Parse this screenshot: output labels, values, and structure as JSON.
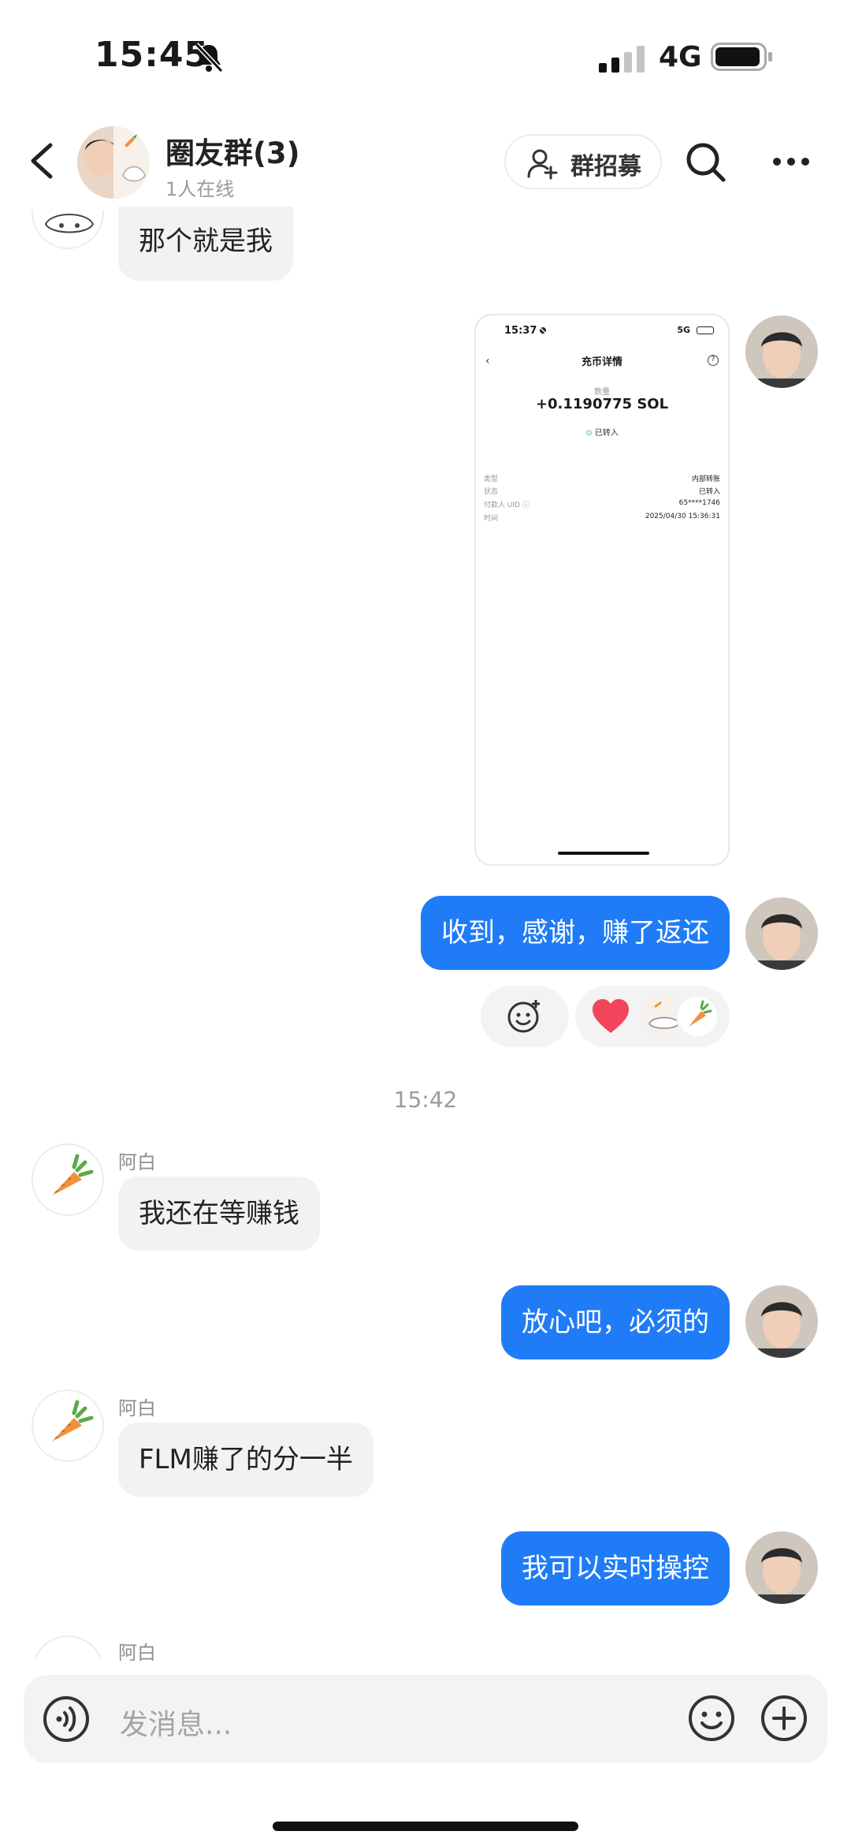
{
  "status_bar": {
    "time": "15:45",
    "network": "4G"
  },
  "header": {
    "title": "圈友群(3)",
    "subtitle": "1人在线",
    "recruit_label": "群招募"
  },
  "messages": {
    "m1": {
      "text": "那个就是我"
    },
    "shared_screenshot": {
      "time": "15:37",
      "network": "5G",
      "title": "充币详情",
      "quantity_label": "数量",
      "amount": "+0.1190775 SOL",
      "status": "已转入",
      "rows": [
        {
          "label": "类型",
          "value": "内部转账"
        },
        {
          "label": "状态",
          "value": "已转入"
        },
        {
          "label": "付款人 UID ⓘ",
          "value": "65****1746"
        },
        {
          "label": "时间",
          "value": "2025/04/30 15:36:31"
        }
      ]
    },
    "m2": {
      "text": "收到，感谢，赚了返还"
    },
    "timestamp": "15:42",
    "m3": {
      "sender": "阿白",
      "text": "我还在等赚钱"
    },
    "m4": {
      "text": "放心吧，必须的"
    },
    "m5": {
      "sender": "阿白",
      "text": "FLM赚了的分一半"
    },
    "m6": {
      "text": "我可以实时操控"
    },
    "m7": {
      "sender": "阿白"
    }
  },
  "input": {
    "placeholder": "发消息..."
  },
  "colors": {
    "accent": "#1f7cf6",
    "incoming_bubble": "#f2f2f2",
    "heart": "#f2445b"
  },
  "icons": [
    "back-icon",
    "add-user-icon",
    "search-icon",
    "more-icon",
    "smile-plus-icon",
    "heart-icon",
    "carrot-icon",
    "voice-icon",
    "emoji-icon",
    "plus-icon"
  ]
}
